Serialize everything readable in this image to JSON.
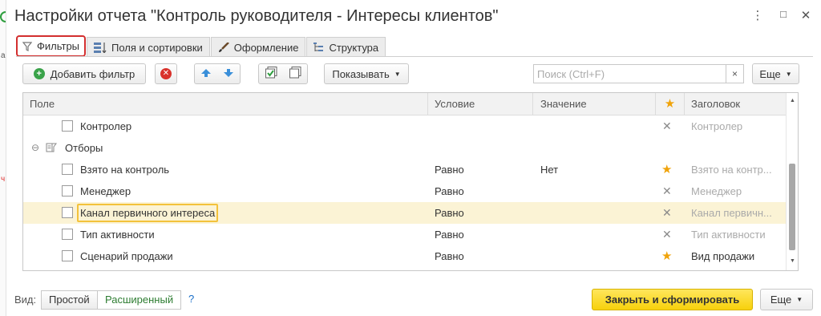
{
  "window": {
    "title": "Настройки отчета \"Контроль руководителя -  Интересы клиентов\"",
    "menu_icon": "⋮",
    "maximize_icon": "□",
    "close_icon": "✕"
  },
  "left_strip": {
    "letter": "а",
    "marker": "ч"
  },
  "tabs": [
    {
      "label": "Фильтры",
      "icon": "funnel-icon",
      "active": true
    },
    {
      "label": "Поля и сортировки",
      "icon": "fields-icon",
      "active": false
    },
    {
      "label": "Оформление",
      "icon": "brush-icon",
      "active": false
    },
    {
      "label": "Структура",
      "icon": "structure-icon",
      "active": false
    }
  ],
  "toolbar": {
    "add_filter": "Добавить фильтр",
    "show": "Показывать",
    "search_placeholder": "Поиск (Ctrl+F)",
    "clear": "×",
    "more": "Еще"
  },
  "table": {
    "columns": {
      "field": "Поле",
      "condition": "Условие",
      "value": "Значение",
      "use": "★",
      "header": "Заголовок"
    },
    "rows": [
      {
        "field": "Контролер",
        "condition": "",
        "value": "",
        "mark": "✕",
        "header": "Контролер",
        "header_dark": false,
        "checkbox": true
      },
      {
        "field": "Отборы",
        "group": true,
        "expander": "⊖"
      },
      {
        "field": "Взято на контроль",
        "condition": "Равно",
        "value": "Нет",
        "mark": "★",
        "header": "Взято на контр...",
        "header_dark": false,
        "checkbox": true
      },
      {
        "field": "Менеджер",
        "condition": "Равно",
        "value": "",
        "mark": "✕",
        "header": "Менеджер",
        "header_dark": false,
        "checkbox": true
      },
      {
        "field": "Канал первичного интереса",
        "condition": "Равно",
        "value": "",
        "mark": "✕",
        "header": "Канал первичн...",
        "header_dark": false,
        "checkbox": true,
        "selected": true
      },
      {
        "field": "Тип активности",
        "condition": "Равно",
        "value": "",
        "mark": "✕",
        "header": "Тип активности",
        "header_dark": false,
        "checkbox": true
      },
      {
        "field": "Сценарий продажи",
        "condition": "Равно",
        "value": "",
        "mark": "★",
        "header": "Вид продажи",
        "header_dark": true,
        "checkbox": true
      }
    ]
  },
  "footer": {
    "view_label": "Вид:",
    "simple": "Простой",
    "extended": "Расширенный",
    "help": "?",
    "close_generate": "Закрыть и сформировать",
    "more": "Еще"
  },
  "colors": {
    "active_tab_border": "#d32f2f",
    "selected_row": "#fbf3d5",
    "highlight_border": "#f3c23b",
    "star": "#f0a30a",
    "primary_button": "#f7d10c",
    "link": "#1a6fc9"
  }
}
